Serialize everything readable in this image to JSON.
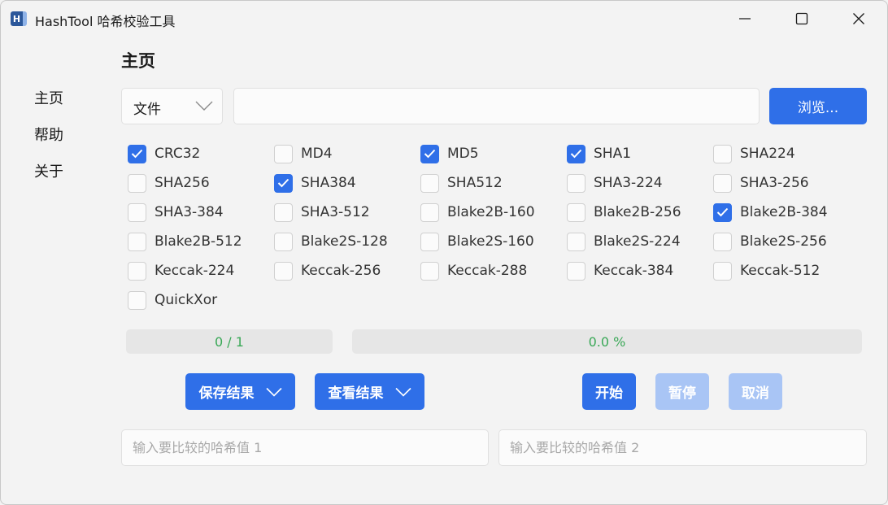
{
  "window": {
    "title": "HashTool 哈希校验工具",
    "icon_letter": "H"
  },
  "sidebar": {
    "items": [
      {
        "label": "主页"
      },
      {
        "label": "帮助"
      },
      {
        "label": "关于"
      }
    ]
  },
  "main": {
    "page_title": "主页",
    "source_select": {
      "value": "文件"
    },
    "path_input": {
      "value": "",
      "placeholder": ""
    },
    "browse_label": "浏览..."
  },
  "algorithms": [
    {
      "label": "CRC32",
      "checked": true
    },
    {
      "label": "MD4",
      "checked": false
    },
    {
      "label": "MD5",
      "checked": true
    },
    {
      "label": "SHA1",
      "checked": true
    },
    {
      "label": "SHA224",
      "checked": false
    },
    {
      "label": "SHA256",
      "checked": false
    },
    {
      "label": "SHA384",
      "checked": true
    },
    {
      "label": "SHA512",
      "checked": false
    },
    {
      "label": "SHA3-224",
      "checked": false
    },
    {
      "label": "SHA3-256",
      "checked": false
    },
    {
      "label": "SHA3-384",
      "checked": false
    },
    {
      "label": "SHA3-512",
      "checked": false
    },
    {
      "label": "Blake2B-160",
      "checked": false
    },
    {
      "label": "Blake2B-256",
      "checked": false
    },
    {
      "label": "Blake2B-384",
      "checked": true
    },
    {
      "label": "Blake2B-512",
      "checked": false
    },
    {
      "label": "Blake2S-128",
      "checked": false
    },
    {
      "label": "Blake2S-160",
      "checked": false
    },
    {
      "label": "Blake2S-224",
      "checked": false
    },
    {
      "label": "Blake2S-256",
      "checked": false
    },
    {
      "label": "Keccak-224",
      "checked": false
    },
    {
      "label": "Keccak-256",
      "checked": false
    },
    {
      "label": "Keccak-288",
      "checked": false
    },
    {
      "label": "Keccak-384",
      "checked": false
    },
    {
      "label": "Keccak-512",
      "checked": false
    },
    {
      "label": "QuickXor",
      "checked": false
    }
  ],
  "progress": {
    "files_text": "0 / 1",
    "files_fraction": 0,
    "percent_text": "0.0 %",
    "percent_value": 0
  },
  "actions": {
    "save_results": "保存结果",
    "view_results": "查看结果",
    "start": "开始",
    "pause": "暂停",
    "cancel": "取消"
  },
  "compare": {
    "hash1_placeholder": "输入要比较的哈希值 1",
    "hash2_placeholder": "输入要比较的哈希值 2"
  },
  "colors": {
    "accent": "#2f6fe8",
    "accent_disabled": "#a9c5f5",
    "progress_text": "#3aa857"
  }
}
